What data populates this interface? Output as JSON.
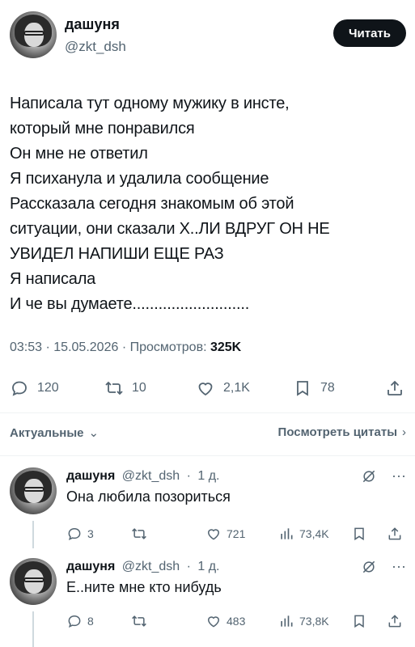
{
  "tweet": {
    "author_name": "дашуня",
    "author_handle": "@zkt_dsh",
    "follow_label": "Читать",
    "lines": [
      "Написала тут одному мужику в инсте,",
      "который мне понравился",
      "Он мне не ответил",
      "Я психанула и удалила сообщение",
      "Рассказала сегодня знакомым об этой",
      "ситуации, они сказали Х..ЛИ ВДРУГ ОН НЕ",
      "УВИДЕЛ НАПИШИ ЕЩЕ РАЗ",
      "Я написала",
      "И че вы думаете..........................."
    ],
    "time": "03:53",
    "date": "15.05.2026",
    "views_label": "Просмотров:",
    "views_count": "325K",
    "replies": "120",
    "retweets": "10",
    "likes": "2,1K",
    "bookmarks": "78"
  },
  "filter": {
    "sort_label": "Актуальные",
    "quotes_label": "Посмотреть цитаты"
  },
  "replies": [
    {
      "name": "дашуня",
      "handle": "@zkt_dsh",
      "age": "1 д.",
      "text": "Она любила позориться",
      "replies": "3",
      "retweets": "",
      "likes": "721",
      "views": "73,4K"
    },
    {
      "name": "дашуня",
      "handle": "@zkt_dsh",
      "age": "1 д.",
      "text": "Е..ните мне кто нибудь",
      "replies": "8",
      "retweets": "",
      "likes": "483",
      "views": "73,8K"
    }
  ],
  "colors": {
    "text": "#0f1419",
    "secondary": "#536471",
    "button_bg": "#0f1419"
  }
}
